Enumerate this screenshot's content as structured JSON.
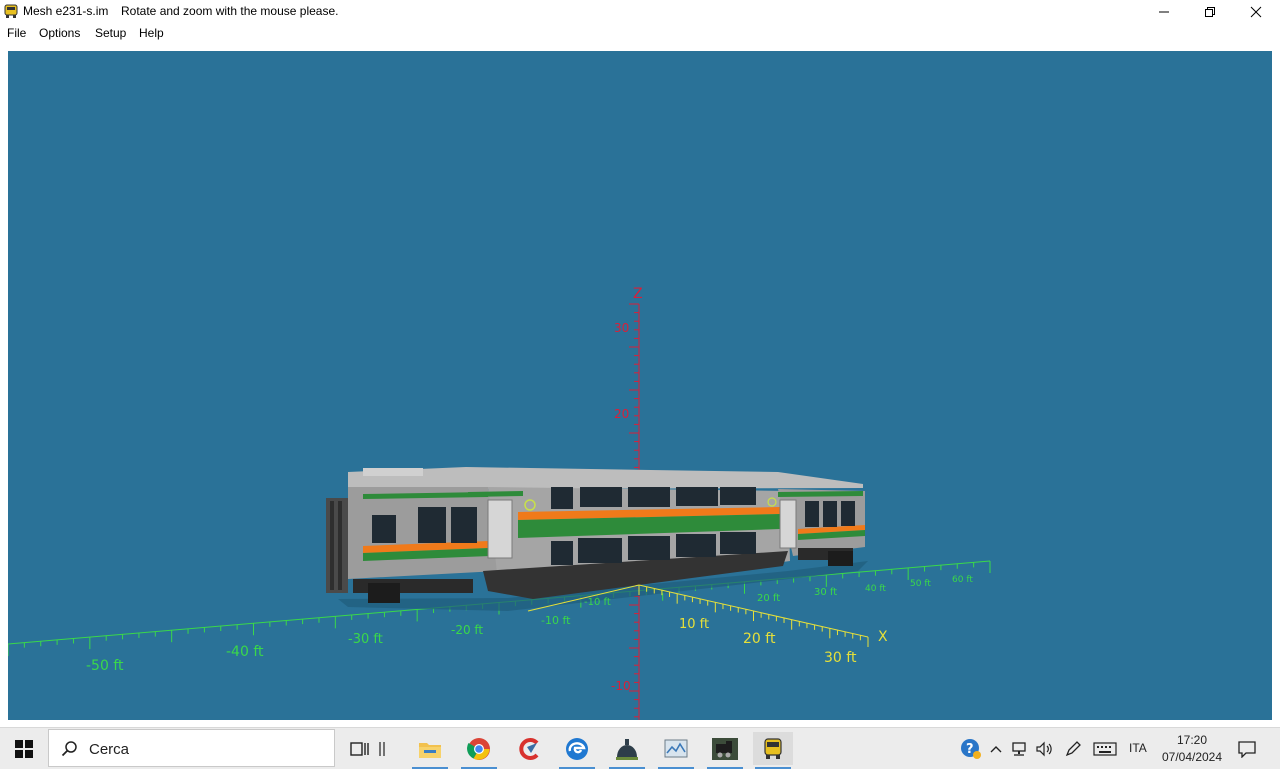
{
  "window": {
    "title": "Mesh e231-s.im",
    "hint": "Rotate and zoom with the mouse please.",
    "controls": [
      "minimize",
      "restore",
      "close"
    ]
  },
  "menu": {
    "items": [
      {
        "label": "File"
      },
      {
        "label": "Options"
      },
      {
        "label": "Setup"
      },
      {
        "label": "Help"
      }
    ]
  },
  "viewport": {
    "background": "#2a7298",
    "z_axis": {
      "label": "Z",
      "ticks": [
        "30",
        "20",
        "-10"
      ],
      "color": "#d8203a"
    },
    "x_axis": {
      "label": "X",
      "ticks_front": [
        "10 ft",
        "20 ft",
        "30 ft"
      ],
      "ticks_back": [
        "-10 ft",
        "20 ft",
        "30 ft",
        "40 ft",
        "50 ft",
        "60 ft"
      ],
      "color": "#e6e03a"
    },
    "y_axis": {
      "ticks": [
        "-50 ft",
        "-40 ft",
        "-30 ft",
        "-20 ft",
        "-10 ft"
      ],
      "color": "#3ad84a"
    },
    "model": {
      "name": "E231 double-deck car",
      "stripe_green": "#2e8b3a",
      "stripe_orange": "#f07a1a",
      "body": "#9a9a9a"
    }
  },
  "taskbar": {
    "search_placeholder": "Cerca",
    "apps": [
      "task-view-icon",
      "file-explorer-icon",
      "chrome-icon",
      "ccleaner-icon",
      "edge-icon",
      "dome-app-icon",
      "image-viewer-icon",
      "locomotive-app-icon",
      "train-app-icon"
    ],
    "tray": {
      "language": "ITA",
      "time": "17:20",
      "date": "07/04/2024"
    }
  }
}
